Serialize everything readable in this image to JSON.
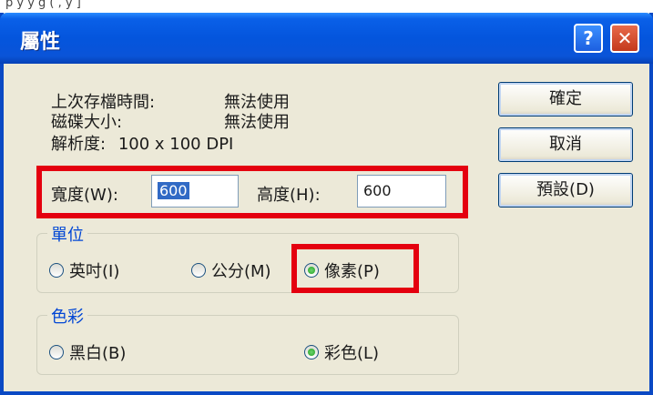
{
  "top_sliver_text": "p    y    y    g    (    ,    y    ]",
  "dialog": {
    "title": "屬性",
    "help_glyph": "?",
    "close_glyph": "✕"
  },
  "info": {
    "last_saved_label": "上次存檔時間:",
    "last_saved_value": "無法使用",
    "size_label": "磁碟大小:",
    "size_value": "無法使用",
    "resolution_label": "解析度:",
    "resolution_value": "100 x 100 DPI"
  },
  "buttons": {
    "ok": "確定",
    "cancel": "取消",
    "default": "預設(D)"
  },
  "dimensions": {
    "width_label": "寬度(W):",
    "width_value": "600",
    "height_label": "高度(H):",
    "height_value": "600"
  },
  "units": {
    "label": "單位",
    "options": [
      "英吋(I)",
      "公分(M)",
      "像素(P)"
    ],
    "selected": "像素(P)"
  },
  "colors": {
    "label": "色彩",
    "options": [
      "黑白(B)",
      "彩色(L)"
    ],
    "selected": "彩色(L)"
  },
  "highlight_color": "#e4000f"
}
